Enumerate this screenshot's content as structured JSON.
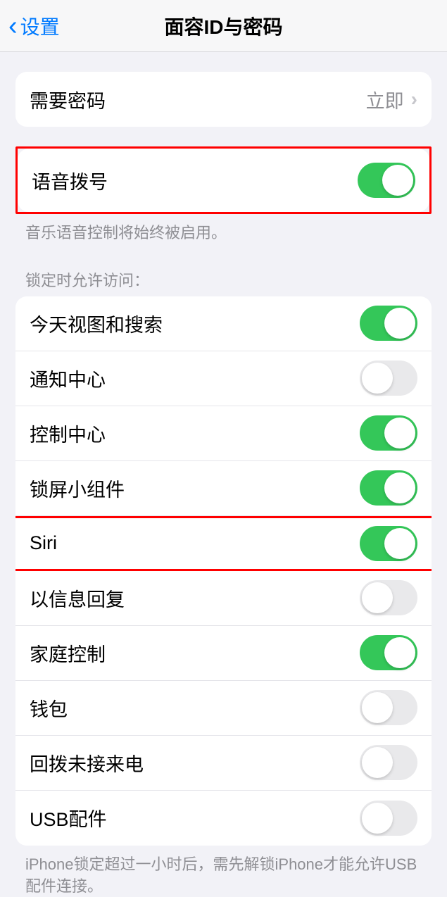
{
  "nav": {
    "back_label": "设置",
    "title": "面容ID与密码"
  },
  "passcode": {
    "require_label": "需要密码",
    "require_value": "立即"
  },
  "voice_dial": {
    "label": "语音拨号",
    "on": true,
    "footer": "音乐语音控制将始终被启用。"
  },
  "locked_access": {
    "header": "锁定时允许访问：",
    "items": [
      {
        "label": "今天视图和搜索",
        "on": true
      },
      {
        "label": "通知中心",
        "on": false
      },
      {
        "label": "控制中心",
        "on": true
      },
      {
        "label": "锁屏小组件",
        "on": true
      },
      {
        "label": "Siri",
        "on": true
      },
      {
        "label": "以信息回复",
        "on": false
      },
      {
        "label": "家庭控制",
        "on": true
      },
      {
        "label": "钱包",
        "on": false
      },
      {
        "label": "回拨未接来电",
        "on": false
      },
      {
        "label": "USB配件",
        "on": false
      }
    ],
    "footer": "iPhone锁定超过一小时后，需先解锁iPhone才能允许USB配件连接。"
  }
}
